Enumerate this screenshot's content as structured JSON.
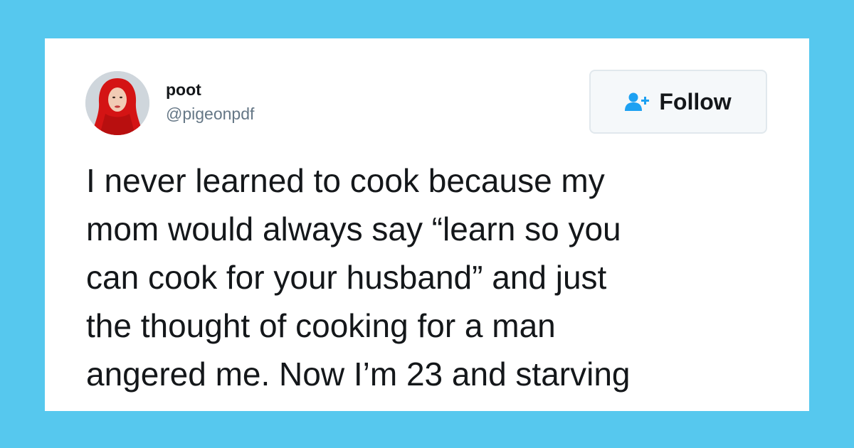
{
  "tweet": {
    "author": {
      "display_name": "poot",
      "handle": "@pigeonpdf",
      "avatar_icon": "profile-photo-red-hijab"
    },
    "follow_button": {
      "label": "Follow",
      "icon": "add-user-icon"
    },
    "text": "I never learned to cook because my\nmom would always say “learn so you\ncan cook for your husband” and just\nthe thought of cooking for a man\nangered me. Now I’m 23 and starving"
  },
  "colors": {
    "background": "#56c8ee",
    "card": "#ffffff",
    "accent": "#1da1f2",
    "text": "#14171a",
    "secondary_text": "#657786"
  }
}
